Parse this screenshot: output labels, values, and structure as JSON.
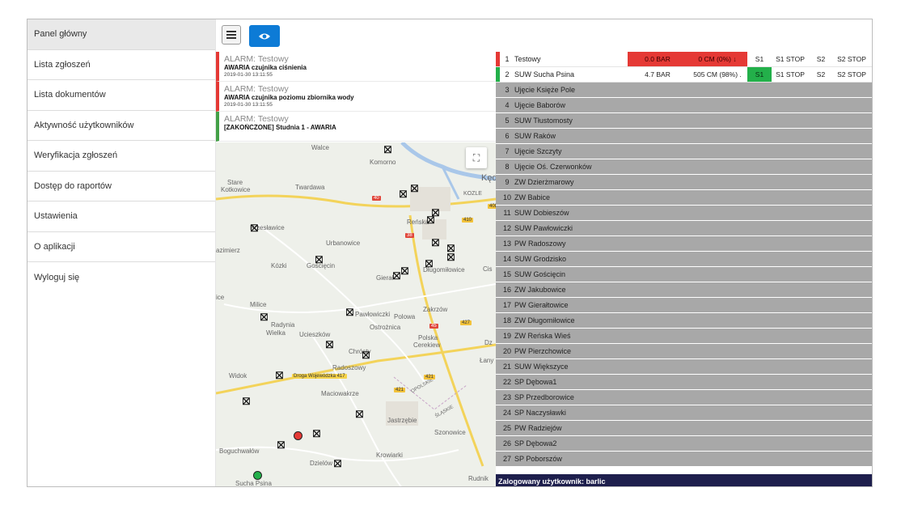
{
  "sidebar": {
    "items": [
      {
        "label": "Panel główny"
      },
      {
        "label": "Lista zgłoszeń"
      },
      {
        "label": "Lista dokumentów"
      },
      {
        "label": "Aktywność użytkowników"
      },
      {
        "label": "Weryfikacja zgłoszeń"
      },
      {
        "label": "Dostęp do raportów"
      },
      {
        "label": "Ustawienia"
      },
      {
        "label": "O aplikacji"
      },
      {
        "label": "Wyloguj się"
      }
    ]
  },
  "toolbar": {
    "menu_icon": "hamburger-icon",
    "eye_icon": "eye-icon",
    "eye_color": "#0d7bd6"
  },
  "alarms": [
    {
      "title": "ALARM: Testowy",
      "desc": "AWARIA czujnika ciśnienia",
      "time": "2019-01-30 13:11:55",
      "status": "active"
    },
    {
      "title": "ALARM: Testowy",
      "desc": "AWARIA czujnika poziomu zbiornika wody",
      "time": "2019-01-30 13:11:55",
      "status": "active"
    },
    {
      "title": "ALARM: Testowy",
      "desc": "[ZAKOŃCZONE] Studnia 1 - AWARIA",
      "time": "",
      "status": "done"
    }
  ],
  "map": {
    "labels": {
      "walce": "Walce",
      "komorno": "Komorno",
      "stare": "Stare",
      "kotkowice": "Kotkowice",
      "twardawa": "Twardawa",
      "ked": "Kęd",
      "kozle": "KOZLE",
      "przeslawice": "Przesławice",
      "renska": "Reńska",
      "kazimierz": "azimierz",
      "urbanowice": "Urbanowice",
      "kozki": "Kózki",
      "goscieciin": "Gościęcin",
      "gierai": "Gierał",
      "dlugomilowice": "Długomiłowice",
      "cise": "Cis",
      "milice": "Milice",
      "pawlowiczki": "Pawłowiczki",
      "polowa": "Polowa",
      "zakrzow": "Zakrzów",
      "radynia": "Radynia",
      "wielka": "Wielka",
      "ostroznica": "Ostrożnica",
      "ucieszkow": "Ucieszków",
      "polska": "Polska",
      "cerekiew": "Cerekiew",
      "chrosty": "Chrósty",
      "lany": "Łany",
      "radoszowy": "Radoszowy",
      "widok": "Widok",
      "droga": "Droga Wojewódzka 417",
      "maciowakrze": "Maciowakrze",
      "jastrzebie": "Jastrzębie",
      "slaskie": "ŚLĄSKIE",
      "opolskie": "OPOLSKIE",
      "szonowice": "Szonowice",
      "boguchwalow": "Boguchwałów",
      "krowiarki": "Krowiarki",
      "dzielow": "Dzielów",
      "sucha": "Sucha Psina",
      "rudnik": "Rudnik",
      "dz": "Dz",
      "ice": "ice",
      "k": "k"
    },
    "road_nums": {
      "r40": "40",
      "r38": "38",
      "r410": "410",
      "r45": "45",
      "r427": "427",
      "r421a": "421",
      "r421b": "421",
      "r408": "408"
    },
    "fullscreen_icon": "fullscreen-icon"
  },
  "stations": [
    {
      "num": "1",
      "name": "Testowy",
      "pressure": "0.0 BAR",
      "level": "0 CM (0%) ↓",
      "s1": "S1",
      "s1stop": "S1 STOP",
      "s2": "S2",
      "s2stop": "S2 STOP",
      "marker": "#e53935"
    },
    {
      "num": "2",
      "name": "SUW Sucha Psina",
      "pressure": "4.7 BAR",
      "level": "505 CM (98%) .",
      "s1": "S1",
      "s1stop": "S1 STOP",
      "s2": "S2",
      "s2stop": "S2 STOP",
      "marker": "#23b04a"
    },
    {
      "num": "3",
      "name": "Ujęcie Księże Pole"
    },
    {
      "num": "4",
      "name": "Ujęcie Baborów"
    },
    {
      "num": "5",
      "name": "SUW Tłustomosty"
    },
    {
      "num": "6",
      "name": "SUW Raków"
    },
    {
      "num": "7",
      "name": "Ujęcie Szczyty"
    },
    {
      "num": "8",
      "name": "Ujęcie Oś. Czerwonków"
    },
    {
      "num": "9",
      "name": "ZW Dzierżmarowy"
    },
    {
      "num": "10",
      "name": "ZW Babice"
    },
    {
      "num": "11",
      "name": "SUW Dobieszów"
    },
    {
      "num": "12",
      "name": "SUW Pawłowiczki"
    },
    {
      "num": "13",
      "name": "PW Radoszowy"
    },
    {
      "num": "14",
      "name": "SUW Grodzisko"
    },
    {
      "num": "15",
      "name": "SUW Gościęcin"
    },
    {
      "num": "16",
      "name": "ZW Jakubowice"
    },
    {
      "num": "17",
      "name": "PW Gierałtowice"
    },
    {
      "num": "18",
      "name": "ZW Długomiłowice"
    },
    {
      "num": "19",
      "name": "ZW Reńska Wieś"
    },
    {
      "num": "20",
      "name": "PW Pierzchowice"
    },
    {
      "num": "21",
      "name": "SUW Większyce"
    },
    {
      "num": "22",
      "name": "SP Dębowa1"
    },
    {
      "num": "23",
      "name": "SP Przedborowice"
    },
    {
      "num": "24",
      "name": "SP Naczysławki"
    },
    {
      "num": "25",
      "name": "PW Radziejów"
    },
    {
      "num": "26",
      "name": "SP Dębowa2"
    },
    {
      "num": "27",
      "name": "SP Poborszów"
    }
  ],
  "status_bar": {
    "text": "Zalogowany użytkownik: barlic"
  },
  "colors": {
    "alarm_red": "#e53935",
    "ok_green": "#23b04a",
    "inactive_gray": "#a8a8a8",
    "status_navy": "#1e1f4d"
  }
}
